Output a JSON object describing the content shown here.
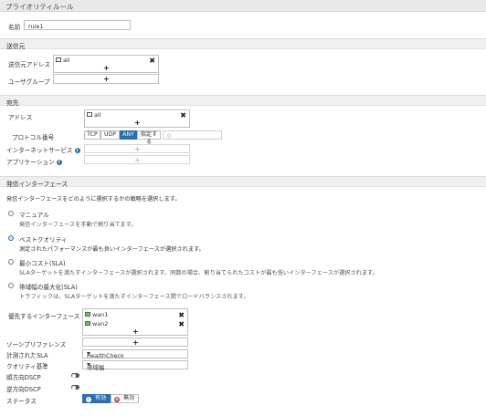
{
  "header": {
    "title": "プライオリティルール"
  },
  "name": {
    "label": "名前",
    "value": "rule1"
  },
  "source": {
    "section": "送信元",
    "address_label": "送信元アドレス",
    "address_entries": [
      "all"
    ],
    "user_group_label": "ユーザグループ"
  },
  "destination": {
    "section": "宛先",
    "address_label": "アドレス",
    "address_entries": [
      "all"
    ],
    "protocol_label": "プロトコル番号",
    "protocol_options": [
      "TCP",
      "UDP",
      "ANY",
      "指定する"
    ],
    "protocol_selected": "ANY",
    "protocol_value": "0",
    "internet_service_label": "インターネットサービス",
    "application_label": "アプリケーション"
  },
  "outgoing": {
    "section": "発信インターフェース",
    "intro": "発信インターフェースをどのように選択するかの戦略を選択します。",
    "strategies": [
      {
        "title": "マニュアル",
        "desc": "発信インターフェースを手動で割り当てます。",
        "selected": false
      },
      {
        "title": "ベストクオリティ",
        "desc": "測定されたパフォーマンスが最も良いインターフェースが選択されます。",
        "selected": true
      },
      {
        "title": "最小コスト(SLA)",
        "desc": "SLAターゲットを満たすインターフェースが選択されます。同数の場合、割り当てられたコストが最も低いインターフェースが選択されます。",
        "selected": false
      },
      {
        "title": "帯域幅の最大化(SLA)",
        "desc": "トラフィックは、SLAターゲットを満たすインターフェース間でロードバランスされます。",
        "selected": false
      }
    ]
  },
  "preferred": {
    "label": "優先するインターフェース",
    "entries": [
      "wan1",
      "wan2"
    ],
    "zone_label": "ゾーンプリファレンス",
    "sla_label": "計測されたSLA",
    "sla_value": "HealthCheck",
    "quality_label": "クオリティ基準",
    "quality_value": "帯域幅",
    "fwd_dscp_label": "順方向DSCP",
    "rev_dscp_label": "逆方向DSCP",
    "status_label": "ステータス",
    "status_enable": "有効",
    "status_disable": "無効"
  },
  "colors": {
    "accent": "#2a6fb0",
    "section_bg": "#efefef",
    "disable_red": "#c0392b"
  }
}
